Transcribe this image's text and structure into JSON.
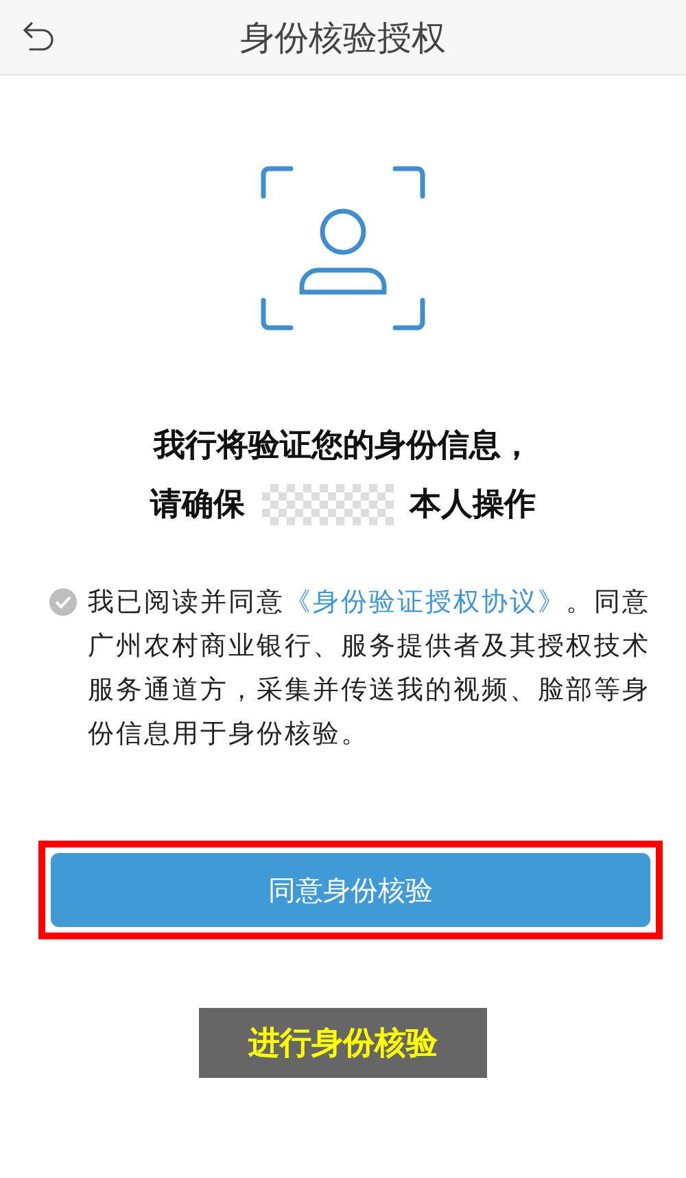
{
  "header": {
    "title": "身份核验授权"
  },
  "prompt": {
    "line1": "我行将验证您的身份信息，",
    "line2_before": "请确保",
    "line2_redacted": true,
    "line2_after": "本人操作"
  },
  "agreement": {
    "checked": true,
    "text_before": "我已阅读并同意",
    "link": "《身份验证授权协议》",
    "text_after": "。同意广州农村商业银行、服务提供者及其授权技术服务通道方，采集并传送我的视频、脸部等身份信息用于身份核验。"
  },
  "primary_button": {
    "label": "同意身份核验",
    "highlighted": true
  },
  "callout": {
    "label": "进行身份核验"
  }
}
